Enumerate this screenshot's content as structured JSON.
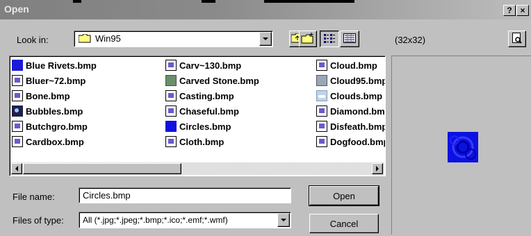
{
  "window": {
    "title": "Open",
    "help_label": "?",
    "close_label": "×"
  },
  "look_in": {
    "label": "Look in:",
    "value": "Win95"
  },
  "preview": {
    "size_label": "(32x32)"
  },
  "files": {
    "column1": [
      "Blue Rivets.bmp",
      "Bluer~72.bmp",
      "Bone.bmp",
      "Bubbles.bmp",
      "Butchgro.bmp",
      "Cardbox.bmp"
    ],
    "column2": [
      "Carv~130.bmp",
      "Carved Stone.bmp",
      "Casting.bmp",
      "Chaseful.bmp",
      "Circles.bmp",
      "Cloth.bmp"
    ],
    "column3": [
      "Cloud.bmp",
      "Cloud95.bmp",
      "Clouds.bmp",
      "Diamond.bmp",
      "Disfeath.bmp",
      "Dogfood.bmp"
    ]
  },
  "file_name": {
    "label": "File name:",
    "value": "Circles.bmp"
  },
  "files_of_type": {
    "label": "Files of type:",
    "value": "All (*.jpg;*.jpeg;*.bmp;*.ico;*.emf;*.wmf)"
  },
  "buttons": {
    "open": "Open",
    "cancel": "Cancel"
  },
  "colors": {
    "preview_square": "#0a12e0",
    "selected_icon": "#1010e0"
  }
}
